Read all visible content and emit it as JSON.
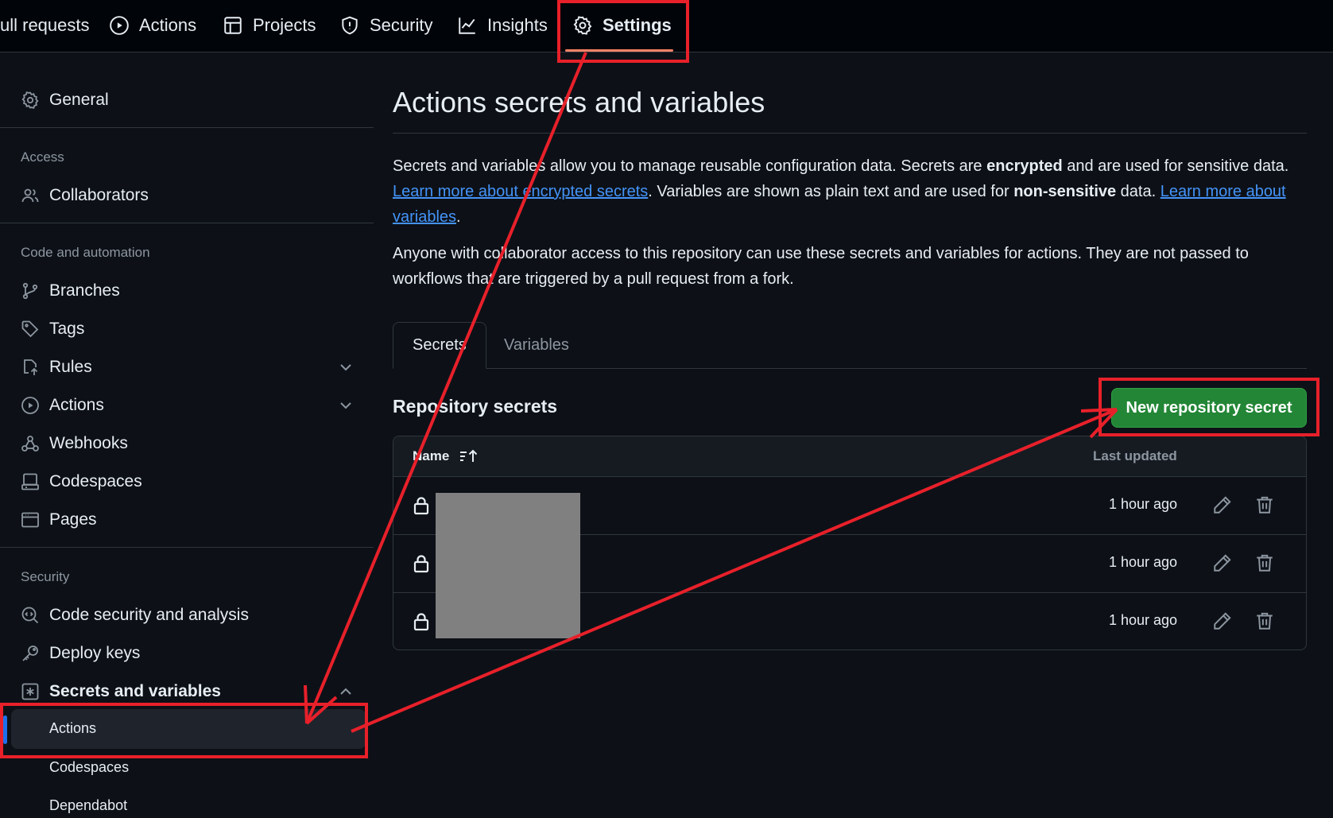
{
  "topnav": {
    "tabs": [
      {
        "label": "ull requests",
        "icon": "pull-request-icon"
      },
      {
        "label": "Actions",
        "icon": "play-circle-icon"
      },
      {
        "label": "Projects",
        "icon": "table-icon"
      },
      {
        "label": "Security",
        "icon": "shield-icon"
      },
      {
        "label": "Insights",
        "icon": "graph-icon"
      },
      {
        "label": "Settings",
        "icon": "gear-icon",
        "active": true
      }
    ]
  },
  "sidebar": {
    "general": "General",
    "access_heading": "Access",
    "collaborators": "Collaborators",
    "code_heading": "Code and automation",
    "branches": "Branches",
    "tags": "Tags",
    "rules": "Rules",
    "actions": "Actions",
    "webhooks": "Webhooks",
    "codespaces": "Codespaces",
    "pages": "Pages",
    "security_heading": "Security",
    "code_security": "Code security and analysis",
    "deploy_keys": "Deploy keys",
    "secrets_vars": "Secrets and variables",
    "sub": {
      "actions": "Actions",
      "codespaces": "Codespaces",
      "dependabot": "Dependabot"
    }
  },
  "main": {
    "title": "Actions secrets and variables",
    "p1": {
      "t1": "Secrets and variables allow you to manage reusable configuration data. Secrets are ",
      "b1": "encrypted",
      "t2": " and are used for sensitive data. ",
      "link1": "Learn more about encrypted secrets",
      "t3": ". Variables are shown as plain text and are used for ",
      "b2": "non-sensitive",
      "t4": " data. ",
      "link2": "Learn more about variables",
      "t5": "."
    },
    "p2": "Anyone with collaborator access to this repository can use these secrets and variables for actions. They are not passed to workflows that are triggered by a pull request from a fork.",
    "tabs": {
      "secrets": "Secrets",
      "variables": "Variables"
    },
    "section_title": "Repository secrets",
    "new_button": "New repository secret",
    "table": {
      "col_name": "Name",
      "col_updated": "Last updated",
      "rows": [
        {
          "updated": "1 hour ago"
        },
        {
          "updated": "1 hour ago"
        },
        {
          "updated": "1 hour ago"
        }
      ]
    }
  },
  "colors": {
    "annotation": "#e8202a",
    "primary_button": "#238636",
    "link": "#4493f8",
    "active_tab_underline": "#f78166"
  }
}
